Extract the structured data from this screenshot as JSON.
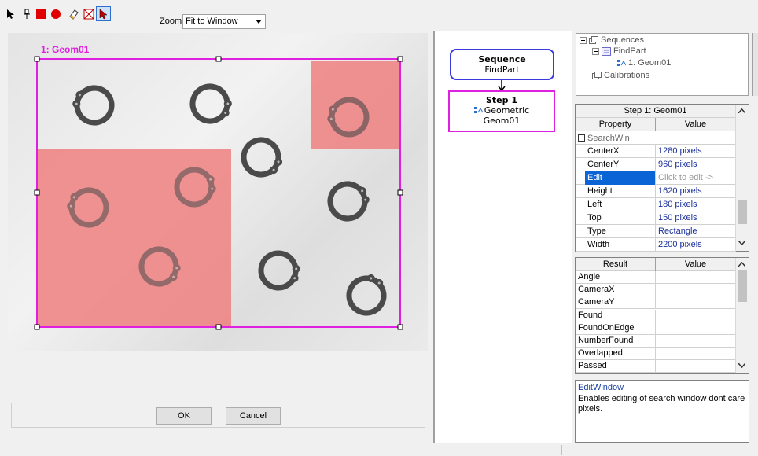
{
  "toolbar": {
    "tools": [
      {
        "name": "select-arrow-icon"
      },
      {
        "name": "pin-tool-icon"
      },
      {
        "name": "rectangle-tool-icon",
        "color": "#e00000"
      },
      {
        "name": "ellipse-tool-icon",
        "color": "#e00000"
      },
      {
        "name": "eraser-icon"
      },
      {
        "name": "dont-care-box-icon"
      },
      {
        "name": "edit-window-arrow-icon",
        "active": true
      }
    ],
    "zoom_label": "Zoom:",
    "zoom_value": "Fit to Window"
  },
  "image": {
    "roi_label": "1: Geom01",
    "roi_color": "#e020e0",
    "dont_care_color": "#f08080"
  },
  "dialog": {
    "ok_label": "OK",
    "cancel_label": "Cancel"
  },
  "flow": {
    "sequence_title": "Sequence",
    "sequence_name": "FindPart",
    "step_title": "Step 1",
    "step_type": "Geometric",
    "step_name": "Geom01",
    "sequence_color": "#3a3ae0",
    "step_color": "#e020e0"
  },
  "tree": {
    "sequences": "Sequences",
    "findpart": "FindPart",
    "geom": "1: Geom01",
    "calibrations": "Calibrations"
  },
  "properties": {
    "title": "Step 1: Geom01",
    "col_property": "Property",
    "col_value": "Value",
    "group": "SearchWin",
    "rows": [
      {
        "name": "CenterX",
        "value": "1280 pixels"
      },
      {
        "name": "CenterY",
        "value": "960 pixels"
      },
      {
        "name": "Edit",
        "value": "Click to edit ->",
        "selected": true
      },
      {
        "name": "Height",
        "value": "1620 pixels"
      },
      {
        "name": "Left",
        "value": "180 pixels"
      },
      {
        "name": "Top",
        "value": "150 pixels"
      },
      {
        "name": "Type",
        "value": "Rectangle"
      },
      {
        "name": "Width",
        "value": "2200 pixels"
      }
    ]
  },
  "results": {
    "col_result": "Result",
    "col_value": "Value",
    "rows": [
      "Angle",
      "CameraX",
      "CameraY",
      "Found",
      "FoundOnEdge",
      "NumberFound",
      "Overlapped",
      "Passed"
    ]
  },
  "help": {
    "title": "EditWindow",
    "text": "Enables editing of search window dont care pixels."
  }
}
